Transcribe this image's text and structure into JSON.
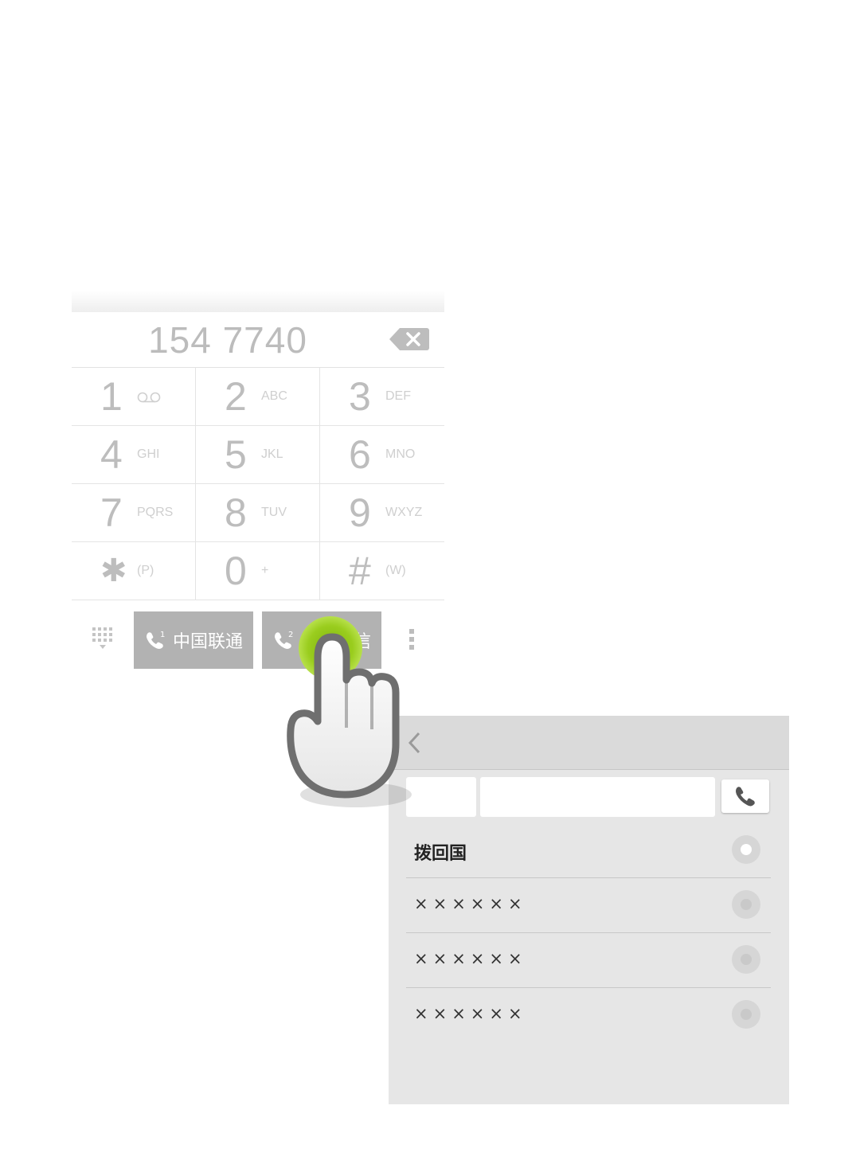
{
  "dialer": {
    "number": "154 7740",
    "keys": [
      {
        "digit": "1",
        "letters": "σο"
      },
      {
        "digit": "2",
        "letters": "ABC"
      },
      {
        "digit": "3",
        "letters": "DEF"
      },
      {
        "digit": "4",
        "letters": "GHI"
      },
      {
        "digit": "5",
        "letters": "JKL"
      },
      {
        "digit": "6",
        "letters": "MNO"
      },
      {
        "digit": "7",
        "letters": "PQRS"
      },
      {
        "digit": "8",
        "letters": "TUV"
      },
      {
        "digit": "9",
        "letters": "WXYZ"
      },
      {
        "digit": "✱",
        "letters": "(P)"
      },
      {
        "digit": "0",
        "letters": "+"
      },
      {
        "digit": "#",
        "letters": "(W)"
      }
    ],
    "sim1": {
      "slot": "1",
      "label": "中国联通"
    },
    "sim2": {
      "slot": "2",
      "label": "中国电信"
    }
  },
  "callback": {
    "options": [
      {
        "label": "拨回国",
        "selected": true
      },
      {
        "label": "××××××",
        "selected": false
      },
      {
        "label": "××××××",
        "selected": false
      },
      {
        "label": "××××××",
        "selected": false
      }
    ]
  },
  "colors": {
    "sim_button": "#b2b2b2",
    "touch_highlight": "#9acd1e",
    "panel_bg": "#e6e6e6"
  }
}
